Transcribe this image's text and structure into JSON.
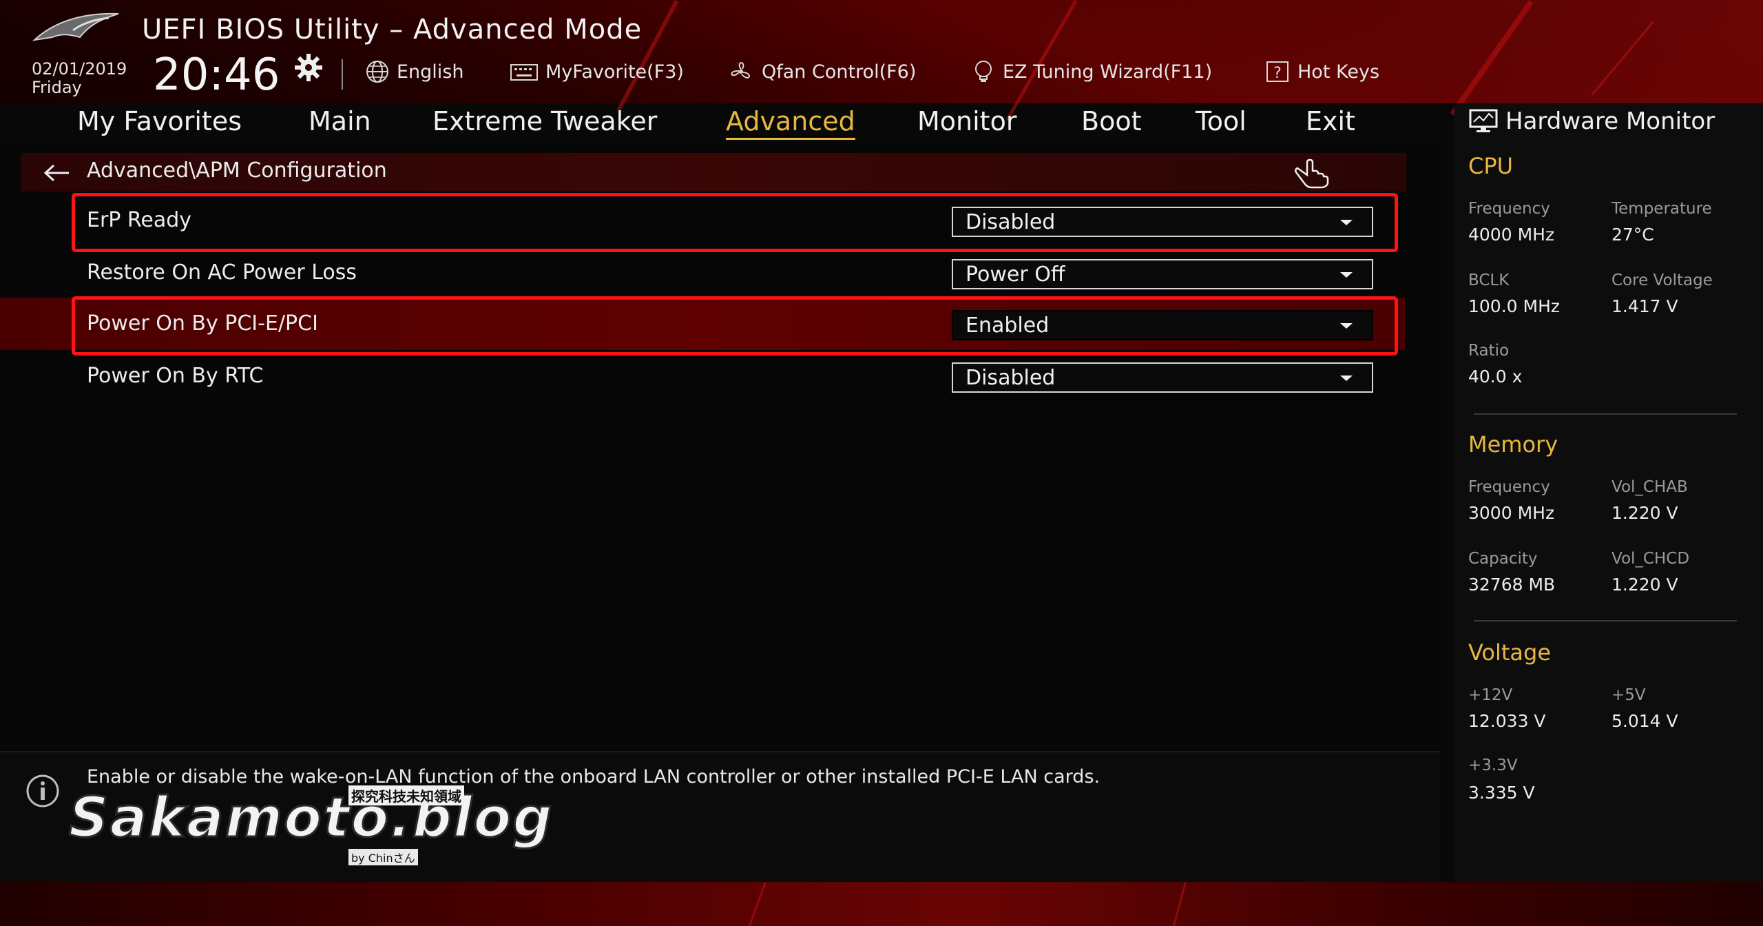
{
  "header": {
    "title": "UEFI BIOS Utility – Advanced Mode",
    "date": "02/01/2019",
    "day": "Friday",
    "time": "20:46",
    "tools": [
      {
        "label": "English",
        "icon": "globe-icon"
      },
      {
        "label": "MyFavorite(F3)",
        "icon": "keyboard-icon"
      },
      {
        "label": "Qfan Control(F6)",
        "icon": "fan-icon"
      },
      {
        "label": "EZ Tuning Wizard(F11)",
        "icon": "lightbulb-icon"
      },
      {
        "label": "Hot Keys",
        "icon": "question-icon"
      }
    ]
  },
  "tabs": [
    {
      "label": "My Favorites",
      "active": false
    },
    {
      "label": "Main",
      "active": false
    },
    {
      "label": "Extreme Tweaker",
      "active": false
    },
    {
      "label": "Advanced",
      "active": true
    },
    {
      "label": "Monitor",
      "active": false
    },
    {
      "label": "Boot",
      "active": false
    },
    {
      "label": "Tool",
      "active": false
    },
    {
      "label": "Exit",
      "active": false
    }
  ],
  "breadcrumb": "Advanced\\APM Configuration",
  "settings": [
    {
      "label": "ErP Ready",
      "value": "Disabled",
      "highlighted": true
    },
    {
      "label": "Restore On AC Power Loss",
      "value": "Power Off",
      "highlighted": false
    },
    {
      "label": "Power On By PCI-E/PCI",
      "value": "Enabled",
      "highlighted": true,
      "selected": true
    },
    {
      "label": "Power On By RTC",
      "value": "Disabled",
      "highlighted": false
    }
  ],
  "help_text": "Enable or disable the wake-on-LAN function of the onboard LAN controller or other installed PCI-E LAN cards.",
  "watermark": {
    "main": "Sakamoto.blog",
    "sub": "探究科技未知領域",
    "by": "by Chinさん"
  },
  "hardware_monitor": {
    "title": "Hardware Monitor",
    "cpu": {
      "heading": "CPU",
      "frequency_label": "Frequency",
      "frequency": "4000 MHz",
      "temperature_label": "Temperature",
      "temperature": "27°C",
      "bclk_label": "BCLK",
      "bclk": "100.0 MHz",
      "core_voltage_label": "Core Voltage",
      "core_voltage": "1.417 V",
      "ratio_label": "Ratio",
      "ratio": "40.0 x"
    },
    "memory": {
      "heading": "Memory",
      "frequency_label": "Frequency",
      "frequency": "3000 MHz",
      "vol_chab_label": "Vol_CHAB",
      "vol_chab": "1.220 V",
      "capacity_label": "Capacity",
      "capacity": "32768 MB",
      "vol_chcd_label": "Vol_CHCD",
      "vol_chcd": "1.220 V"
    },
    "voltage": {
      "heading": "Voltage",
      "v12_label": "+12V",
      "v12": "12.033 V",
      "v5_label": "+5V",
      "v5": "5.014 V",
      "v33_label": "+3.3V",
      "v33": "3.335 V"
    }
  },
  "colors": {
    "accent": "#e8b740",
    "highlight_border": "#ff1212",
    "selected_row": "#5e0000"
  }
}
